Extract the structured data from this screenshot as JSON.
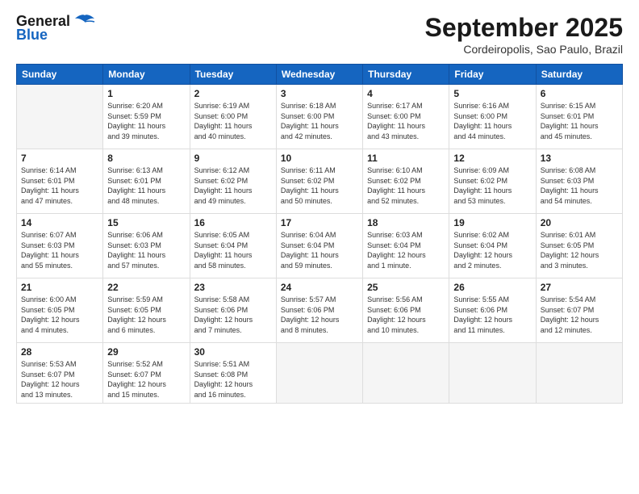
{
  "header": {
    "logo_general": "General",
    "logo_blue": "Blue",
    "month_title": "September 2025",
    "location": "Cordeiropolis, Sao Paulo, Brazil"
  },
  "weekdays": [
    "Sunday",
    "Monday",
    "Tuesday",
    "Wednesday",
    "Thursday",
    "Friday",
    "Saturday"
  ],
  "weeks": [
    [
      {
        "day": "",
        "info": ""
      },
      {
        "day": "1",
        "info": "Sunrise: 6:20 AM\nSunset: 5:59 PM\nDaylight: 11 hours\nand 39 minutes."
      },
      {
        "day": "2",
        "info": "Sunrise: 6:19 AM\nSunset: 6:00 PM\nDaylight: 11 hours\nand 40 minutes."
      },
      {
        "day": "3",
        "info": "Sunrise: 6:18 AM\nSunset: 6:00 PM\nDaylight: 11 hours\nand 42 minutes."
      },
      {
        "day": "4",
        "info": "Sunrise: 6:17 AM\nSunset: 6:00 PM\nDaylight: 11 hours\nand 43 minutes."
      },
      {
        "day": "5",
        "info": "Sunrise: 6:16 AM\nSunset: 6:00 PM\nDaylight: 11 hours\nand 44 minutes."
      },
      {
        "day": "6",
        "info": "Sunrise: 6:15 AM\nSunset: 6:01 PM\nDaylight: 11 hours\nand 45 minutes."
      }
    ],
    [
      {
        "day": "7",
        "info": "Sunrise: 6:14 AM\nSunset: 6:01 PM\nDaylight: 11 hours\nand 47 minutes."
      },
      {
        "day": "8",
        "info": "Sunrise: 6:13 AM\nSunset: 6:01 PM\nDaylight: 11 hours\nand 48 minutes."
      },
      {
        "day": "9",
        "info": "Sunrise: 6:12 AM\nSunset: 6:02 PM\nDaylight: 11 hours\nand 49 minutes."
      },
      {
        "day": "10",
        "info": "Sunrise: 6:11 AM\nSunset: 6:02 PM\nDaylight: 11 hours\nand 50 minutes."
      },
      {
        "day": "11",
        "info": "Sunrise: 6:10 AM\nSunset: 6:02 PM\nDaylight: 11 hours\nand 52 minutes."
      },
      {
        "day": "12",
        "info": "Sunrise: 6:09 AM\nSunset: 6:02 PM\nDaylight: 11 hours\nand 53 minutes."
      },
      {
        "day": "13",
        "info": "Sunrise: 6:08 AM\nSunset: 6:03 PM\nDaylight: 11 hours\nand 54 minutes."
      }
    ],
    [
      {
        "day": "14",
        "info": "Sunrise: 6:07 AM\nSunset: 6:03 PM\nDaylight: 11 hours\nand 55 minutes."
      },
      {
        "day": "15",
        "info": "Sunrise: 6:06 AM\nSunset: 6:03 PM\nDaylight: 11 hours\nand 57 minutes."
      },
      {
        "day": "16",
        "info": "Sunrise: 6:05 AM\nSunset: 6:04 PM\nDaylight: 11 hours\nand 58 minutes."
      },
      {
        "day": "17",
        "info": "Sunrise: 6:04 AM\nSunset: 6:04 PM\nDaylight: 11 hours\nand 59 minutes."
      },
      {
        "day": "18",
        "info": "Sunrise: 6:03 AM\nSunset: 6:04 PM\nDaylight: 12 hours\nand 1 minute."
      },
      {
        "day": "19",
        "info": "Sunrise: 6:02 AM\nSunset: 6:04 PM\nDaylight: 12 hours\nand 2 minutes."
      },
      {
        "day": "20",
        "info": "Sunrise: 6:01 AM\nSunset: 6:05 PM\nDaylight: 12 hours\nand 3 minutes."
      }
    ],
    [
      {
        "day": "21",
        "info": "Sunrise: 6:00 AM\nSunset: 6:05 PM\nDaylight: 12 hours\nand 4 minutes."
      },
      {
        "day": "22",
        "info": "Sunrise: 5:59 AM\nSunset: 6:05 PM\nDaylight: 12 hours\nand 6 minutes."
      },
      {
        "day": "23",
        "info": "Sunrise: 5:58 AM\nSunset: 6:06 PM\nDaylight: 12 hours\nand 7 minutes."
      },
      {
        "day": "24",
        "info": "Sunrise: 5:57 AM\nSunset: 6:06 PM\nDaylight: 12 hours\nand 8 minutes."
      },
      {
        "day": "25",
        "info": "Sunrise: 5:56 AM\nSunset: 6:06 PM\nDaylight: 12 hours\nand 10 minutes."
      },
      {
        "day": "26",
        "info": "Sunrise: 5:55 AM\nSunset: 6:06 PM\nDaylight: 12 hours\nand 11 minutes."
      },
      {
        "day": "27",
        "info": "Sunrise: 5:54 AM\nSunset: 6:07 PM\nDaylight: 12 hours\nand 12 minutes."
      }
    ],
    [
      {
        "day": "28",
        "info": "Sunrise: 5:53 AM\nSunset: 6:07 PM\nDaylight: 12 hours\nand 13 minutes."
      },
      {
        "day": "29",
        "info": "Sunrise: 5:52 AM\nSunset: 6:07 PM\nDaylight: 12 hours\nand 15 minutes."
      },
      {
        "day": "30",
        "info": "Sunrise: 5:51 AM\nSunset: 6:08 PM\nDaylight: 12 hours\nand 16 minutes."
      },
      {
        "day": "",
        "info": ""
      },
      {
        "day": "",
        "info": ""
      },
      {
        "day": "",
        "info": ""
      },
      {
        "day": "",
        "info": ""
      }
    ]
  ]
}
